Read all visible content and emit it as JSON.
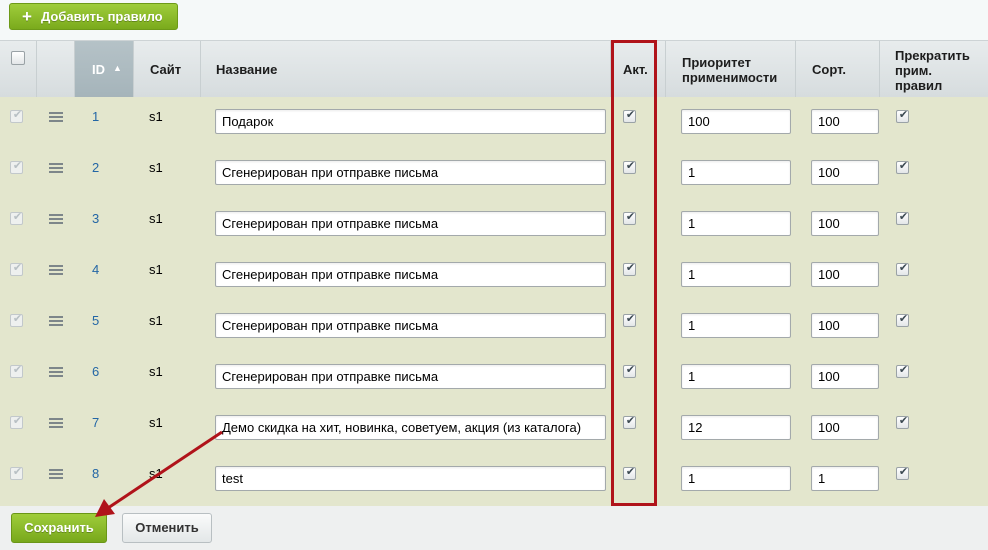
{
  "toolbar": {
    "add_label": "Добавить правило"
  },
  "header": {
    "id": "ID",
    "site": "Сайт",
    "name": "Название",
    "active": "Акт.",
    "priority_line1": "Приоритет",
    "priority_line2": "применимости",
    "sort": "Сорт.",
    "stop_line1": "Прекратить",
    "stop_line2": "прим.",
    "stop_line3": "правил"
  },
  "rows": [
    {
      "id": "1",
      "site": "s1",
      "name": "Подарок",
      "active": true,
      "priority": "100",
      "sort": "100",
      "stop": true
    },
    {
      "id": "2",
      "site": "s1",
      "name": "Сгенерирован при отправке письма",
      "active": true,
      "priority": "1",
      "sort": "100",
      "stop": true
    },
    {
      "id": "3",
      "site": "s1",
      "name": "Сгенерирован при отправке письма",
      "active": true,
      "priority": "1",
      "sort": "100",
      "stop": true
    },
    {
      "id": "4",
      "site": "s1",
      "name": "Сгенерирован при отправке письма",
      "active": true,
      "priority": "1",
      "sort": "100",
      "stop": true
    },
    {
      "id": "5",
      "site": "s1",
      "name": "Сгенерирован при отправке письма",
      "active": true,
      "priority": "1",
      "sort": "100",
      "stop": true
    },
    {
      "id": "6",
      "site": "s1",
      "name": "Сгенерирован при отправке письма",
      "active": true,
      "priority": "1",
      "sort": "100",
      "stop": true
    },
    {
      "id": "7",
      "site": "s1",
      "name": "Демо скидка на хит, новинка, советуем, акция (из каталога)",
      "active": true,
      "priority": "12",
      "sort": "100",
      "stop": true
    },
    {
      "id": "8",
      "site": "s1",
      "name": "test",
      "active": true,
      "priority": "1",
      "sort": "1",
      "stop": true
    }
  ],
  "footer": {
    "save_label": "Сохранить",
    "cancel_label": "Отменить"
  },
  "colors": {
    "accent_green": "#8cbf2a",
    "highlight_red": "#b0131a",
    "row_bg": "#e3e6cd",
    "link": "#2366a5"
  },
  "icons": {
    "sort": "sort-asc-icon",
    "drag": "menu-icon",
    "check": "checkmark-icon"
  }
}
